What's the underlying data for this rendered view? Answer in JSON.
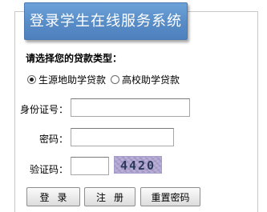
{
  "header": {
    "title": "登录学生在线服务系统"
  },
  "form": {
    "loan_type_label": "请选择您的贷款类型：",
    "loan_options": [
      {
        "label": "生源地助学贷款",
        "selected": true
      },
      {
        "label": "高校助学贷款",
        "selected": false
      }
    ],
    "id_label": "身份证号：",
    "id_value": "",
    "password_label": "密码：",
    "password_value": "",
    "captcha_label": "验证码：",
    "captcha_value": "",
    "captcha_image_text": "4420"
  },
  "buttons": {
    "login": "登录",
    "register": "注册",
    "reset_password": "重置密码"
  }
}
